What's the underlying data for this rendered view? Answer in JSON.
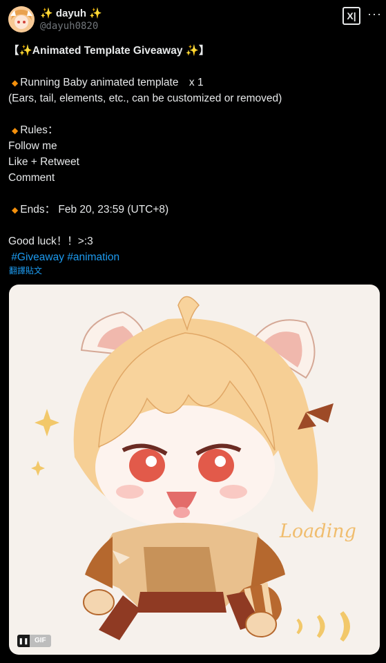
{
  "author": {
    "display_name": "✨ dayuh ✨",
    "handle": "@dayuh0820"
  },
  "header": {
    "x_button_label": "X|",
    "more_label": "···"
  },
  "tweet": {
    "title": "【✨Animated Template Giveaway ✨】",
    "prize_line": "Running Baby animated template　x 1",
    "prize_note": "(Ears, tail, elements, etc., can be customized or removed)",
    "rules_heading": "Rules：",
    "rule_1": "Follow me",
    "rule_2": "Like + Retweet",
    "rule_3": "Comment",
    "ends_line": "Ends： Feb 20, 23:59 (UTC+8)",
    "closing": "Good luck！！>:3",
    "hashtag_1": "#Giveaway",
    "hashtag_2": "#animation",
    "translate_label": "翻譯貼文"
  },
  "media": {
    "overlay_text": "Loading",
    "gif_label": "GIF",
    "pause_icon": "pause-icon"
  },
  "colors": {
    "background": "#000000",
    "text": "#e7e9ea",
    "muted": "#71767b",
    "link": "#1d9bf0",
    "diamond": "#f4900c",
    "media_bg": "#f6f1ec"
  }
}
